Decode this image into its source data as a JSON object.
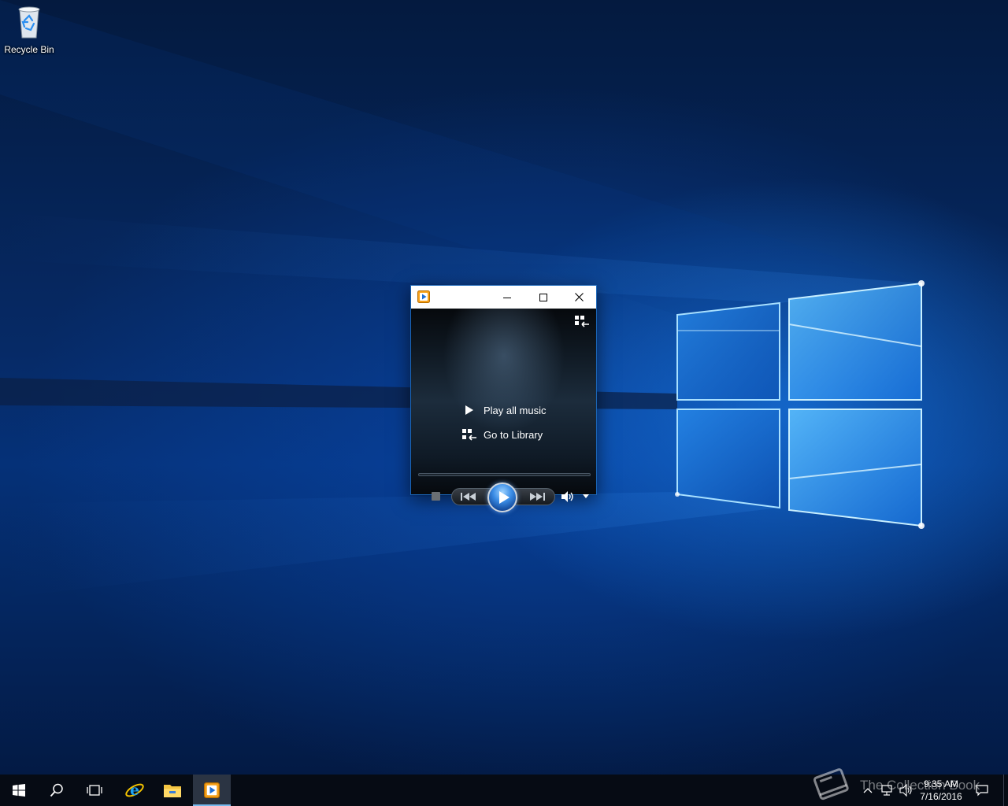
{
  "desktop": {
    "icons": [
      {
        "label": "Recycle Bin",
        "icon": "recycle-bin-icon"
      }
    ]
  },
  "wmp_window": {
    "app_icon": "windows-media-player-icon",
    "title": "",
    "controls": {
      "minimize": "minimize-icon",
      "maximize": "maximize-icon",
      "close": "close-icon"
    },
    "switch_to_library_icon": "switch-to-library-icon",
    "menu": {
      "play_all_music": "Play all music",
      "go_to_library": "Go to Library"
    },
    "transport": {
      "stop": "stop-icon",
      "previous": "previous-icon",
      "play": "play-icon",
      "next": "next-icon",
      "volume": "volume-icon",
      "volume_dropdown": "chevron-down-icon"
    },
    "seek_progress": 0
  },
  "taskbar": {
    "start": "windows-start-icon",
    "search": "search-icon",
    "task_view": "task-view-icon",
    "pinned": [
      "internet-explorer-icon",
      "file-explorer-icon",
      "windows-media-player-icon"
    ],
    "active": "windows-media-player-icon",
    "tray": {
      "icons": [
        "chevron-up-icon",
        "network-icon",
        "speaker-icon",
        "action-center-icon"
      ],
      "time": "9:35 AM",
      "date": "7/16/2016"
    }
  },
  "watermark": {
    "text": "The Collection Book"
  },
  "colors": {
    "accent": "#76b9ed",
    "wallpaper_blue": "#0a58c8",
    "taskbar": "#060b14"
  }
}
